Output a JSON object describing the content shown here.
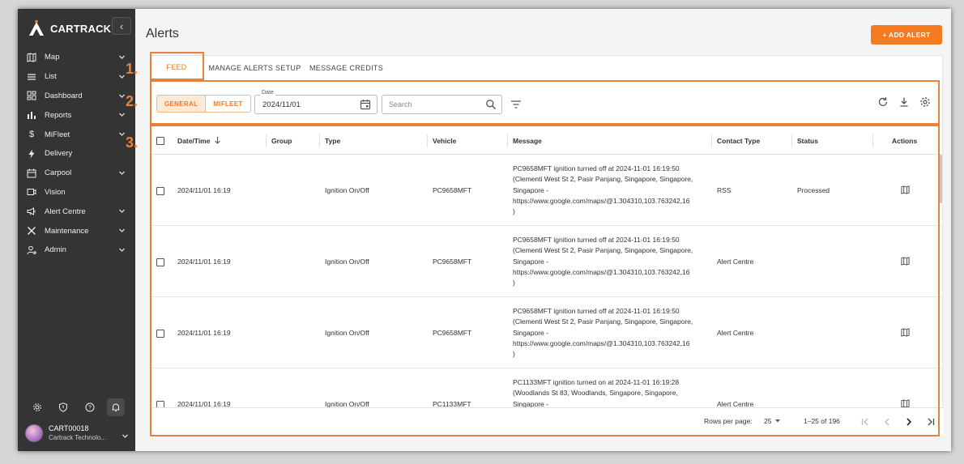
{
  "sidebar": {
    "brand": "CARTRACK",
    "collapse_icon": "chevron-left-icon",
    "items": [
      {
        "label": "Map",
        "icon": "map-icon",
        "expandable": true
      },
      {
        "label": "List",
        "icon": "list-icon",
        "expandable": true
      },
      {
        "label": "Dashboard",
        "icon": "dashboard-icon",
        "expandable": true
      },
      {
        "label": "Reports",
        "icon": "bar-chart-icon",
        "expandable": true
      },
      {
        "label": "MiFleet",
        "icon": "dollar-icon",
        "expandable": true
      },
      {
        "label": "Delivery",
        "icon": "bolt-icon",
        "expandable": false
      },
      {
        "label": "Carpool",
        "icon": "calendar-icon",
        "expandable": true
      },
      {
        "label": "Vision",
        "icon": "camera-icon",
        "expandable": false
      },
      {
        "label": "Alert Centre",
        "icon": "megaphone-icon",
        "expandable": true
      },
      {
        "label": "Maintenance",
        "icon": "tools-icon",
        "expandable": true
      },
      {
        "label": "Admin",
        "icon": "user-gear-icon",
        "expandable": true
      }
    ],
    "bottom_icons": [
      "settings-icon",
      "shield-icon",
      "help-icon",
      "bell-icon"
    ],
    "user": {
      "name": "CART00018",
      "company": "Cartrack Technolo..."
    }
  },
  "header": {
    "title": "Alerts",
    "add_button": "+ ADD ALERT"
  },
  "tabs": [
    {
      "label": "FEED",
      "active": true
    },
    {
      "label": "MANAGE ALERTS SETUP",
      "active": false
    },
    {
      "label": "MESSAGE CREDITS",
      "active": false
    }
  ],
  "toolbar": {
    "segments": [
      {
        "label": "GENERAL",
        "active": true
      },
      {
        "label": "MIFLEET",
        "active": false
      }
    ],
    "date_label": "Date",
    "date_value": "2024/11/01",
    "search_placeholder": "Search"
  },
  "table": {
    "columns": [
      "Date/Time",
      "Group",
      "Type",
      "Vehicle",
      "Message",
      "Contact Type",
      "Status",
      "Actions"
    ],
    "rows": [
      {
        "datetime": "2024/11/01 16:19",
        "group": "",
        "type": "Ignition On/Off",
        "vehicle": "PC9658MFT",
        "message": [
          "PC9658MFT ignition turned off at 2024-11-01 16:19:50",
          "(Clementi West St 2, Pasir Panjang, Singapore, Singapore,",
          "Singapore -",
          "https://www.google.com/maps/@1.304310,103.763242,16",
          ")"
        ],
        "contact_type": "RSS",
        "status": "Processed",
        "action_icon": "map-icon"
      },
      {
        "datetime": "2024/11/01 16:19",
        "group": "",
        "type": "Ignition On/Off",
        "vehicle": "PC9658MFT",
        "message": [
          "PC9658MFT ignition turned off at 2024-11-01 16:19:50",
          "(Clementi West St 2, Pasir Panjang, Singapore, Singapore,",
          "Singapore -",
          "https://www.google.com/maps/@1.304310,103.763242,16",
          ")"
        ],
        "contact_type": "Alert Centre",
        "status": "",
        "action_icon": "map-icon"
      },
      {
        "datetime": "2024/11/01 16:19",
        "group": "",
        "type": "Ignition On/Off",
        "vehicle": "PC9658MFT",
        "message": [
          "PC9658MFT ignition turned off at 2024-11-01 16:19:50",
          "(Clementi West St 2, Pasir Panjang, Singapore, Singapore,",
          "Singapore -",
          "https://www.google.com/maps/@1.304310,103.763242,16",
          ")"
        ],
        "contact_type": "Alert Centre",
        "status": "",
        "action_icon": "map-icon"
      },
      {
        "datetime": "2024/11/01 16:19",
        "group": "",
        "type": "Ignition On/Off",
        "vehicle": "PC1133MFT",
        "message": [
          "PC1133MFT ignition turned on at 2024-11-01 16:19:28",
          "(Woodlands St 83, Woodlands, Singapore, Singapore,",
          "Singapore -",
          "",
          ""
        ],
        "contact_type": "Alert Centre",
        "status": "",
        "action_icon": "map-icon"
      }
    ]
  },
  "footer": {
    "rows_per_page_label": "Rows per page:",
    "rows_per_page": "25",
    "range": "1–25 of 196"
  },
  "annotations": [
    "1.",
    "2.",
    "3."
  ],
  "colors": {
    "accent": "#f47b20",
    "annotation": "#e9813a",
    "sidebar": "#343434"
  }
}
